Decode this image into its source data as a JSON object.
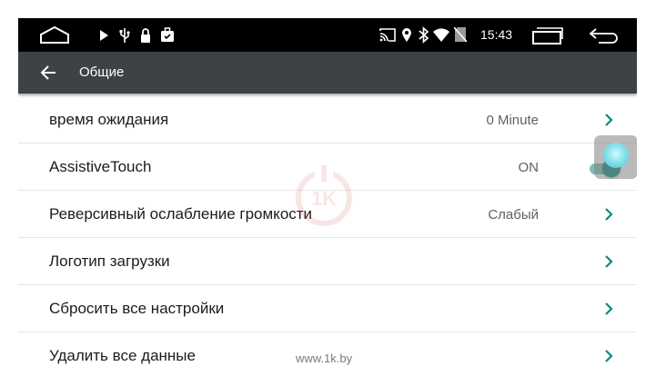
{
  "status_bar": {
    "time": "15:43",
    "left_icons": [
      "home-icon",
      "play-icon",
      "usb-icon",
      "lock-icon",
      "briefcase-icon"
    ],
    "right_icons": [
      "cast-icon",
      "location-icon",
      "bluetooth-icon",
      "wifi-icon",
      "no-sim-icon"
    ],
    "nav_icons": [
      "recent-apps-icon",
      "back-nav-icon"
    ]
  },
  "app_bar": {
    "title": "Общие",
    "back_icon": "arrow-left-icon"
  },
  "settings": [
    {
      "title": "время ожидания",
      "value": "0 Minute",
      "control": "chevron"
    },
    {
      "title": "AssistiveTouch",
      "value": "ON",
      "control": "toggle",
      "toggle_on": true
    },
    {
      "title": "Реверсивный ослабление громкости",
      "value": "Слабый",
      "control": "chevron"
    },
    {
      "title": "Логотип загрузки",
      "value": "",
      "control": "chevron"
    },
    {
      "title": "Сбросить все настройки",
      "value": "",
      "control": "chevron"
    },
    {
      "title": "Удалить все данные",
      "value": "",
      "control": "chevron"
    }
  ],
  "watermark": {
    "logo": "1k",
    "url": "www.1k.by"
  },
  "colors": {
    "status_bar_bg": "#000000",
    "app_bar_bg": "#3d4246",
    "accent": "#0b8a7f",
    "chevron": "#0b8a7f",
    "text": "#1c1c1c",
    "value_text": "#616161"
  }
}
